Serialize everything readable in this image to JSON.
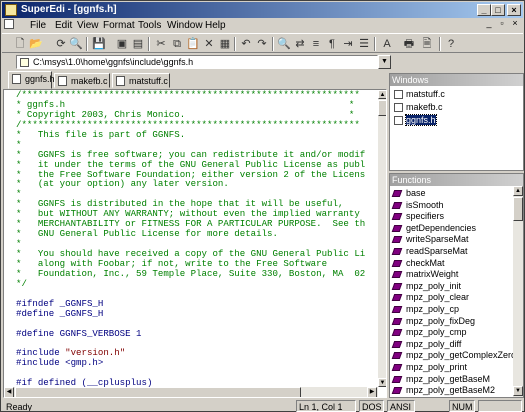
{
  "window": {
    "title": "SuperEdi - [ggnfs.h]"
  },
  "menubar": {
    "items": [
      "File",
      "Edit",
      "View",
      "Format",
      "Tools",
      "Window",
      "Help"
    ]
  },
  "toolbar": {
    "icons": [
      "new-file-icon",
      "open-file-icon",
      "reload-icon",
      "search-file-icon",
      "save-icon",
      "save-all-icon",
      "print-preview-icon",
      "cut-icon",
      "copy-icon",
      "paste-icon",
      "delete-icon",
      "undo-icon",
      "redo-icon",
      "find-icon",
      "replace-icon",
      "goto-icon",
      "paragraph-icon",
      "bookmark-icon",
      "indent-icon",
      "wrap-icon",
      "font-icon",
      "print-icon",
      "page-setup-icon",
      "help-icon"
    ]
  },
  "pathbar": {
    "value": "C:\\msys\\1.0\\home\\ggnfs\\include\\ggnfs.h"
  },
  "tabs": [
    {
      "label": "ggnfs.h",
      "active": true
    },
    {
      "label": "makefb.c",
      "active": false
    },
    {
      "label": "matstuff.c",
      "active": false
    }
  ],
  "editor": {
    "lines": [
      {
        "t": "/**************************************************************",
        "c": "cm"
      },
      {
        "t": "* ggnfs.h                                                    *",
        "c": "cm"
      },
      {
        "t": "* Copyright 2003, Chris Monico.                              *",
        "c": "cm"
      },
      {
        "t": "/**************************************************************",
        "c": "cm"
      },
      {
        "t": "*   This file is part of GGNFS.",
        "c": "cm"
      },
      {
        "t": "*",
        "c": "cm"
      },
      {
        "t": "*   GGNFS is free software; you can redistribute it and/or modif",
        "c": "cm"
      },
      {
        "t": "*   it under the terms of the GNU General Public License as publ",
        "c": "cm"
      },
      {
        "t": "*   the Free Software Foundation; either version 2 of the Licens",
        "c": "cm"
      },
      {
        "t": "*   (at your option) any later version.",
        "c": "cm"
      },
      {
        "t": "*",
        "c": "cm"
      },
      {
        "t": "*   GGNFS is distributed in the hope that it will be useful,",
        "c": "cm"
      },
      {
        "t": "*   but WITHOUT ANY WARRANTY; without even the implied warranty",
        "c": "cm"
      },
      {
        "t": "*   MERCHANTABILITY or FITNESS FOR A PARTICULAR PURPOSE.  See th",
        "c": "cm"
      },
      {
        "t": "*   GNU General Public License for more details.",
        "c": "cm"
      },
      {
        "t": "*",
        "c": "cm"
      },
      {
        "t": "*   You should have received a copy of the GNU General Public Li",
        "c": "cm"
      },
      {
        "t": "*   along with Foobar; if not, write to the Free Software",
        "c": "cm"
      },
      {
        "t": "*   Foundation, Inc., 59 Temple Place, Suite 330, Boston, MA  02",
        "c": "cm"
      },
      {
        "t": "*/",
        "c": "cm"
      },
      {
        "t": "",
        "c": ""
      },
      {
        "t": "#ifndef _GGNFS_H",
        "c": "pp"
      },
      {
        "t": "#define _GGNFS_H",
        "c": "pp"
      },
      {
        "t": "",
        "c": ""
      },
      {
        "t": "#define GGNFS_VERBOSE 1",
        "c": "pp"
      },
      {
        "t": "",
        "c": ""
      },
      {
        "t": "#include ",
        "c": "pp",
        "s": "\"version.h\""
      },
      {
        "t": "#include <gmp.h>",
        "c": "pp"
      },
      {
        "t": "",
        "c": ""
      },
      {
        "t": "#if defined (__cplusplus)",
        "c": "pp"
      },
      {
        "t": "extern ",
        "c": "kw",
        "s": "\"C\" {"
      },
      {
        "t": "#endif",
        "c": "pp"
      }
    ]
  },
  "windows_panel": {
    "title": "Windows",
    "items": [
      {
        "label": "matstuff.c",
        "selected": false
      },
      {
        "label": "makefb.c",
        "selected": false
      },
      {
        "label": "ggnfs.h",
        "selected": true
      }
    ]
  },
  "functions_panel": {
    "title": "Functions",
    "items": [
      "base",
      "isSmooth",
      "specifiers",
      "getDependencies",
      "writeSparseMat",
      "readSparseMat",
      "checkMat",
      "matrixWeight",
      "mpz_poly_init",
      "mpz_poly_clear",
      "mpz_poly_cp",
      "mpz_poly_fixDeg",
      "mpz_poly_cmp",
      "mpz_poly_diff",
      "mpz_poly_getComplexZeros",
      "mpz_poly_print",
      "mpz_poly_getBaseM",
      "mpz_poly_getBaseM2"
    ]
  },
  "statusbar": {
    "status": "Ready",
    "position": "Ln 1, Col 1",
    "format": "DOS",
    "encoding": "ANSI",
    "numlock": "NUM"
  },
  "colors": {
    "titlebar": "#0a246a",
    "comment": "#008000",
    "preprocessor": "#000080",
    "string": "#800000",
    "function_icon": "#800080"
  }
}
